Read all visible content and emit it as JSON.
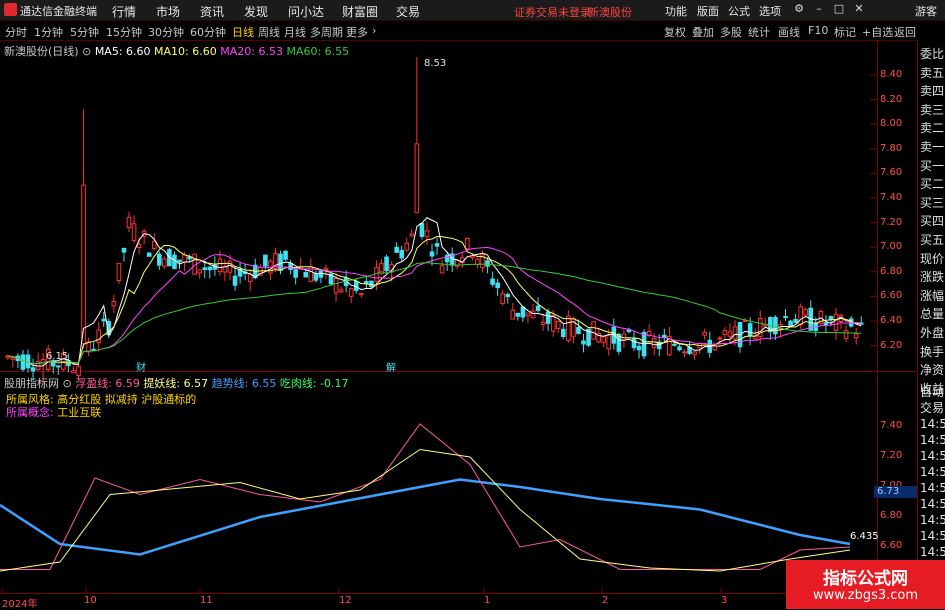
{
  "app": {
    "name": "通达信金融终端",
    "user": "游客"
  },
  "menu": [
    "行情",
    "市场",
    "资讯",
    "发现",
    "问小达",
    "财富圈",
    "交易"
  ],
  "warning": [
    "证券交易未登录",
    "新澳股份"
  ],
  "top_tools": [
    "功能",
    "版面",
    "公式",
    "选项"
  ],
  "periods": [
    "分时",
    "1分钟",
    "5分钟",
    "15分钟",
    "30分钟",
    "60分钟",
    "日线",
    "周线",
    "月线",
    "多周期",
    "更多"
  ],
  "active_period": "日线",
  "right_tools": [
    "复权",
    "叠加",
    "多股",
    "统计",
    "画线",
    "F10",
    "标记",
    "+自选",
    "返回"
  ],
  "main_legend": {
    "title": "新澳股份(日线)",
    "ma5": "MA5: 6.60",
    "ma10": "MA10: 6.60",
    "ma20": "MA20: 6.53",
    "ma60": "MA60: 6.55"
  },
  "colors": {
    "up": "#ff3030",
    "down": "#3fe0f0",
    "ma5": "#ffffff",
    "ma10": "#ffff66",
    "ma20": "#ff44ff",
    "ma60": "#33cc33",
    "grid": "#7a0000",
    "axis_text": "#ff5050"
  },
  "price_axis": [
    "8.40",
    "8.20",
    "8.00",
    "7.80",
    "7.60",
    "7.40",
    "7.20",
    "7.00",
    "6.80",
    "6.60",
    "6.40",
    "6.20"
  ],
  "price_markers": {
    "high": "8.53",
    "low": "6.15",
    "event1": "财",
    "event2": "解"
  },
  "indicator": {
    "name": "股朋指标网",
    "l1": "浮盈线: 6.59",
    "l2": "提妖线: 6.57",
    "l3": "趋势线: 6.55",
    "l4": "吃肉线: -0.17",
    "style_label": "所属风格:",
    "style_value": "高分红股 拟减持 沪股通标的",
    "concept_label": "所属概念:",
    "concept_value": "工业互联",
    "axis": [
      "7.40",
      "7.20",
      "7.00",
      "6.80",
      "6.60",
      "6.40"
    ],
    "cursor_value": "6.73",
    "last_value": "6.435"
  },
  "right_tabs_top": [
    "委比",
    "卖五",
    "卖四",
    "卖三",
    "卖二",
    "卖一",
    "买一",
    "买二",
    "买三",
    "买四",
    "买五",
    "现价",
    "涨跌",
    "涨幅",
    "总量",
    "外盘",
    "换手",
    "净资",
    "收益"
  ],
  "right_tabs_bottom": [
    "自动",
    "交易",
    "14:5",
    "14:5",
    "14:5",
    "14:5",
    "14:5",
    "14:5",
    "14:5",
    "14:5",
    "14:5"
  ],
  "dates": [
    "2024年",
    "10",
    "11",
    "12",
    "1",
    "2",
    "3"
  ],
  "watermark": {
    "line1": "指标公式网",
    "line2": "www.zbgs3.com"
  },
  "chart_data": {
    "type": "line",
    "title": "新澳股份(日线)",
    "x": [
      "2024年",
      "10",
      "11",
      "12",
      "1",
      "2",
      "3"
    ],
    "series": [
      {
        "name": "MA5",
        "values": [
          6.3,
          7.15,
          6.95,
          7.1,
          7.3,
          6.55,
          6.55,
          6.6
        ]
      },
      {
        "name": "MA10",
        "values": [
          6.28,
          7.05,
          6.9,
          7.05,
          7.2,
          6.6,
          6.52,
          6.6
        ]
      },
      {
        "name": "MA20",
        "values": [
          6.4,
          6.85,
          6.95,
          6.95,
          7.15,
          6.65,
          6.45,
          6.53
        ]
      },
      {
        "name": "MA60",
        "values": [
          6.65,
          6.55,
          6.65,
          6.85,
          7.05,
          6.9,
          6.7,
          6.55
        ]
      }
    ],
    "ylim": [
      6.1,
      8.6
    ]
  }
}
